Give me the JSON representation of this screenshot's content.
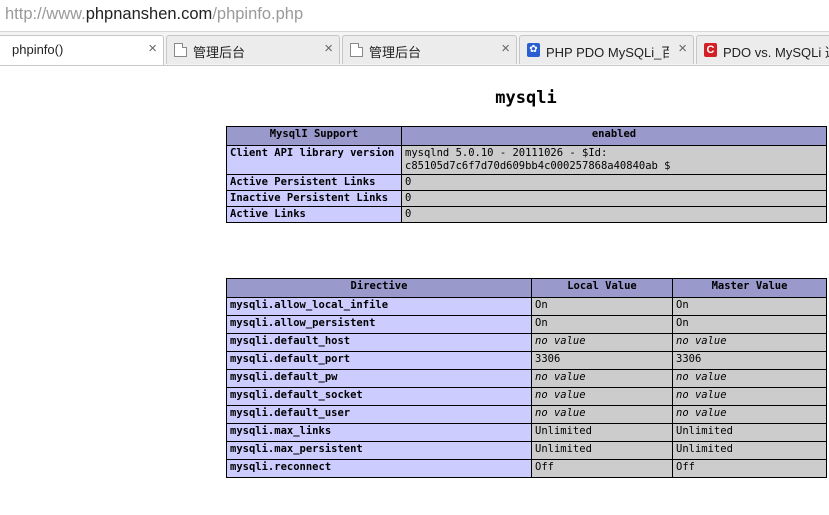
{
  "address_bar": {
    "prefix": "http://www.",
    "host": "phpnanshen.com",
    "path": "/phpinfo.php"
  },
  "tabs": [
    {
      "label": "phpinfo()",
      "icon": "page-icon",
      "active": true
    },
    {
      "label": "管理后台",
      "icon": "page-icon"
    },
    {
      "label": "管理后台",
      "icon": "page-icon"
    },
    {
      "label": "PHP PDO MySQLi_百度",
      "icon": "paw-icon"
    },
    {
      "label": "PDO vs. MySQLi 选",
      "icon": "c-icon"
    }
  ],
  "close_glyph": "×",
  "module_title": "mysqli",
  "support_table": {
    "header": [
      "MysqlI Support",
      "enabled"
    ],
    "rows": [
      {
        "name": "Client API library version",
        "value": "mysqlnd 5.0.10 - 20111026 - $Id: c85105d7c6f7d70d609bb4c000257868a40840ab $"
      },
      {
        "name": "Active Persistent Links",
        "value": "0"
      },
      {
        "name": "Inactive Persistent Links",
        "value": "0"
      },
      {
        "name": "Active Links",
        "value": "0"
      }
    ]
  },
  "directive_table": {
    "header": [
      "Directive",
      "Local Value",
      "Master Value"
    ],
    "rows": [
      {
        "name": "mysqli.allow_local_infile",
        "local": "On",
        "master": "On"
      },
      {
        "name": "mysqli.allow_persistent",
        "local": "On",
        "master": "On"
      },
      {
        "name": "mysqli.default_host",
        "local": "no value",
        "master": "no value"
      },
      {
        "name": "mysqli.default_port",
        "local": "3306",
        "master": "3306"
      },
      {
        "name": "mysqli.default_pw",
        "local": "no value",
        "master": "no value"
      },
      {
        "name": "mysqli.default_socket",
        "local": "no value",
        "master": "no value"
      },
      {
        "name": "mysqli.default_user",
        "local": "no value",
        "master": "no value"
      },
      {
        "name": "mysqli.max_links",
        "local": "Unlimited",
        "master": "Unlimited"
      },
      {
        "name": "mysqli.max_persistent",
        "local": "Unlimited",
        "master": "Unlimited"
      },
      {
        "name": "mysqli.reconnect",
        "local": "Off",
        "master": "Off"
      }
    ]
  }
}
